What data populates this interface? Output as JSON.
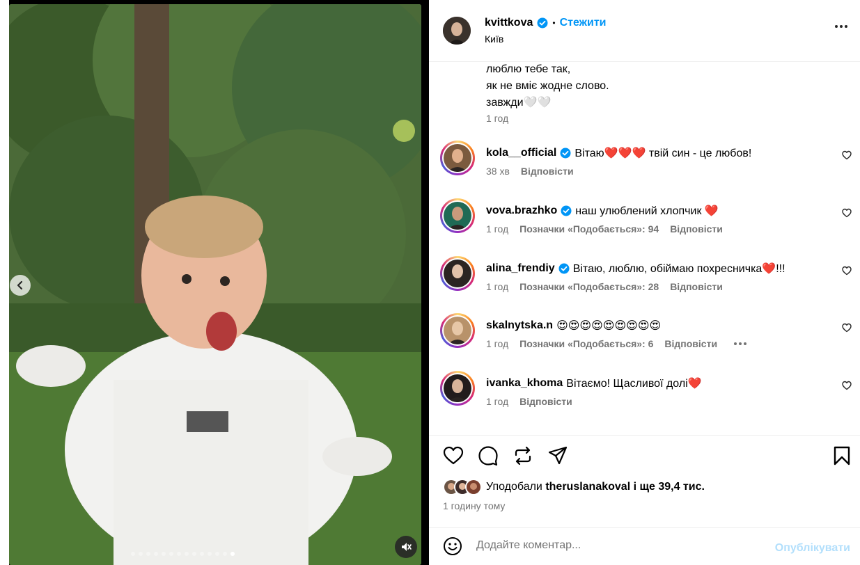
{
  "post": {
    "username": "kvittkova",
    "follow_label": "Стежити",
    "location": "Київ",
    "caption_lines": [
      "люблю тебе так,",
      "як не вміє жодне слово.",
      "завжди🤍🤍"
    ],
    "caption_time": "1 год"
  },
  "comments": [
    {
      "user": "kola__official",
      "verified": true,
      "text": "Вітаю❤️❤️❤️ твій син - це любов!",
      "time": "38 хв",
      "likes": "",
      "reply": "Відповісти"
    },
    {
      "user": "vova.brazhko",
      "verified": true,
      "text": "наш улюблений хлопчик ❤️",
      "time": "1 год",
      "likes": "Позначки «Подобається»: 94",
      "reply": "Відповісти"
    },
    {
      "user": "alina_frendiy",
      "verified": true,
      "text": "Вітаю, люблю, обіймаю похресничка❤️!!!",
      "time": "1 год",
      "likes": "Позначки «Подобається»: 28",
      "reply": "Відповісти"
    },
    {
      "user": "skalnytska.n",
      "verified": false,
      "text": "😍😍😍😍😍😍😍😍😍",
      "time": "1 год",
      "likes": "Позначки «Подобається»: 6",
      "reply": "Відповісти"
    },
    {
      "user": "ivanka_khoma",
      "verified": false,
      "text": "Вітаємо! Щасливої долі❤️",
      "time": "1 год",
      "likes": "",
      "reply": "Відповісти"
    }
  ],
  "likes": {
    "prefix": "Уподобали",
    "user": "theruslanakoval",
    "suffix": "і ще 39,4 тис."
  },
  "post_time": "1 годину тому",
  "comment_box": {
    "placeholder": "Додайте коментар...",
    "post_label": "Опублікувати"
  },
  "carousel": {
    "total": 14,
    "active_index": 13
  },
  "colors": {
    "accent": "#0095f6",
    "muted": "#737373",
    "post_disabled": "#b2dffc"
  }
}
